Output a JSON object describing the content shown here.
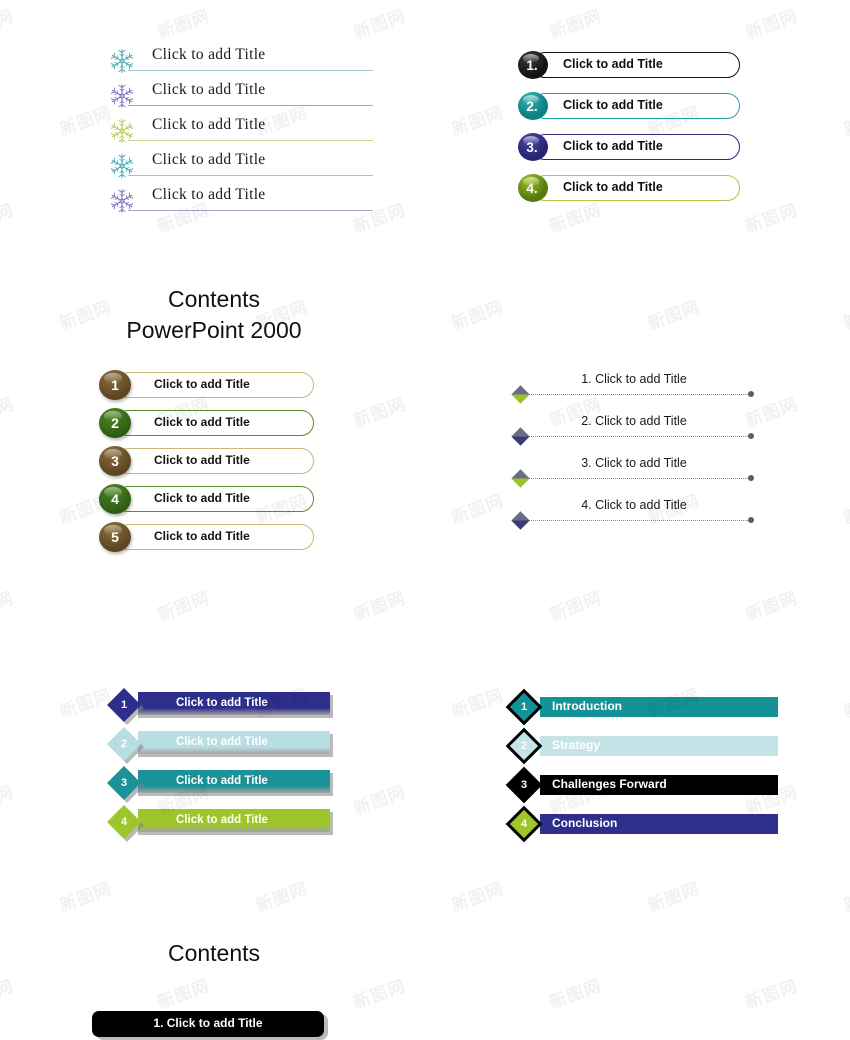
{
  "document": {
    "title": "PowerPoint Contents Slide Templates",
    "background": "#ffffff",
    "watermark_text": "新图网"
  },
  "snowflake_list": {
    "name": "snowflake-bullet-list",
    "items": [
      {
        "label": "Click to add Title",
        "icon": "snowflake-icon",
        "color": "#4ba7b5",
        "line_color": "#9fc6cf"
      },
      {
        "label": "Click to add Title",
        "icon": "snowflake-icon",
        "color": "#7b74c4",
        "line_color": "#a7a3cf"
      },
      {
        "label": "Click to add Title",
        "icon": "snowflake-icon",
        "color": "#b5cc5a",
        "line_color": "#c6d491"
      },
      {
        "label": "Click to add Title",
        "icon": "snowflake-icon",
        "color": "#4ba7b5",
        "line_color": "#9fc6cf"
      },
      {
        "label": "Click to add Title",
        "icon": "snowflake-icon",
        "color": "#7b74c4",
        "line_color": "#a7a3cf"
      }
    ]
  },
  "pill_list": {
    "name": "numbered-pill-list",
    "items": [
      {
        "number": "1.",
        "label": "Click to add Title",
        "circle_color": "#141414",
        "circle_color_2": "#3a3a3a",
        "border_color": "#111111"
      },
      {
        "number": "2.",
        "label": "Click to add Title",
        "circle_color": "#0e7f84",
        "circle_color_2": "#35b5b8",
        "border_color": "#2aa3ab"
      },
      {
        "number": "3.",
        "label": "Click to add Title",
        "circle_color": "#262672",
        "circle_color_2": "#4a4aa0",
        "border_color": "#2c2c7a"
      },
      {
        "number": "4.",
        "label": "Click to add Title",
        "circle_color": "#587a0e",
        "circle_color_2": "#9cc22a",
        "border_color": "#a8c94a"
      }
    ]
  },
  "contents_heading_1": {
    "line1": "Contents",
    "line2": "PowerPoint 2000"
  },
  "contents_heading_2": {
    "line1": "Contents"
  },
  "cream_list": {
    "name": "cream-numbered-bar-list",
    "items": [
      {
        "number": "1",
        "label": "Click to add Title",
        "circle_top": "#8c6f40",
        "circle_bottom": "#5a4220",
        "bar_bg": "#f6f0cf",
        "bar_border": "#c9b87a"
      },
      {
        "number": "2",
        "label": "Click to add Title",
        "circle_top": "#4f8a2a",
        "circle_bottom": "#2d5a12",
        "bar_bg": "#f6f0cf",
        "bar_border": "#5d8c2e"
      },
      {
        "number": "3",
        "label": "Click to add Title",
        "circle_top": "#8c6f40",
        "circle_bottom": "#5a4220",
        "bar_bg": "#f6f0cf",
        "bar_border": "#c9b87a"
      },
      {
        "number": "4",
        "label": "Click to add Title",
        "circle_top": "#4f8a2a",
        "circle_bottom": "#2d5a12",
        "bar_bg": "#f6f0cf",
        "bar_border": "#5d8c2e"
      },
      {
        "number": "5",
        "label": "Click to add Title",
        "circle_top": "#8c6f40",
        "circle_bottom": "#5a4220",
        "bar_bg": "#f6f0cf",
        "bar_border": "#c9b87a"
      }
    ]
  },
  "dotted_list": {
    "name": "dotted-diamond-list",
    "items": [
      {
        "label": "1. Click to add Title",
        "diamond_color": "#9cc22a",
        "diamond_color_2": "#6b6b8a"
      },
      {
        "label": "2. Click to add Title",
        "diamond_color": "#3a3a7a",
        "diamond_color_2": "#6b6b8a"
      },
      {
        "label": "3. Click to add Title",
        "diamond_color": "#9cc22a",
        "diamond_color_2": "#6b6b8a"
      },
      {
        "label": "4. Click to add Title",
        "diamond_color": "#3a3a7a",
        "diamond_color_2": "#6b6b8a"
      }
    ]
  },
  "chevron_left": {
    "name": "chevron-bar-list-placeholder",
    "items": [
      {
        "number": "1",
        "label": "Click to add Title",
        "bar_color": "#2e2e8c",
        "diamond_color": "#2e2e8c"
      },
      {
        "number": "2",
        "label": "Click to add Title",
        "bar_color": "#b8dde3",
        "diamond_color": "#b8dde3"
      },
      {
        "number": "3",
        "label": "Click to add Title",
        "bar_color": "#1a9298",
        "diamond_color": "#1a9298"
      },
      {
        "number": "4",
        "label": "Click to add Title",
        "bar_color": "#9cc62a",
        "diamond_color": "#9cc62a"
      }
    ]
  },
  "chevron_right": {
    "name": "chevron-bar-list-agenda",
    "items": [
      {
        "number": "1",
        "label": "Introduction",
        "bar_color": "#139397",
        "diamond_color": "#139397"
      },
      {
        "number": "2",
        "label": "Strategy",
        "bar_color": "#c6e3e8",
        "diamond_color": "#c6e3e8"
      },
      {
        "number": "3",
        "label": "Challenges Forward",
        "bar_color": "#000000",
        "diamond_color": "#000000"
      },
      {
        "number": "4",
        "label": "Conclusion",
        "bar_color": "#2e2e8c",
        "diamond_color": "#9cc62a"
      }
    ]
  },
  "bottom_bar": {
    "label": "1. Click to add Title"
  }
}
